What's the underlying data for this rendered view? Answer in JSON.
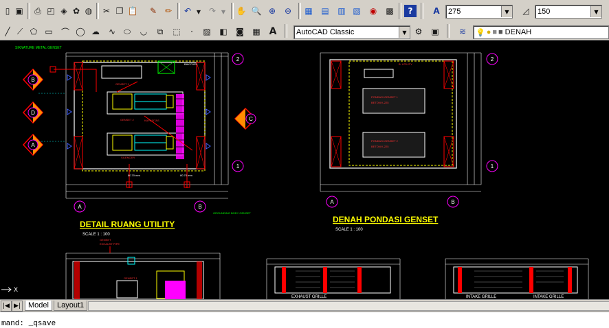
{
  "toolbar": {
    "lineweight_value": "275",
    "linescale_value": "150",
    "workspace_value": "AutoCAD Classic",
    "layer_value": "DENAH"
  },
  "drawing": {
    "left_plan_title": "DETAIL RUANG UTILITY",
    "left_plan_scale": "SCALE 1 : 100",
    "right_plan_title": "DENAH PONDASI GENSET",
    "right_plan_scale": "SCALE 1 : 100",
    "grid_A": "A",
    "grid_B": "B",
    "grid_C": "C",
    "grid_D": "D",
    "grid_1": "1",
    "grid_2": "2",
    "section_label_1": "EXHAUST GRILLE",
    "section_label_2": "INTAKE GRILLE",
    "section_label_3": "INTAKE GRILLE",
    "ucs_x": "X"
  },
  "tabs": {
    "model": "Model",
    "layout1": "Layout1"
  },
  "command": {
    "prompt": "mand: _qsave"
  }
}
